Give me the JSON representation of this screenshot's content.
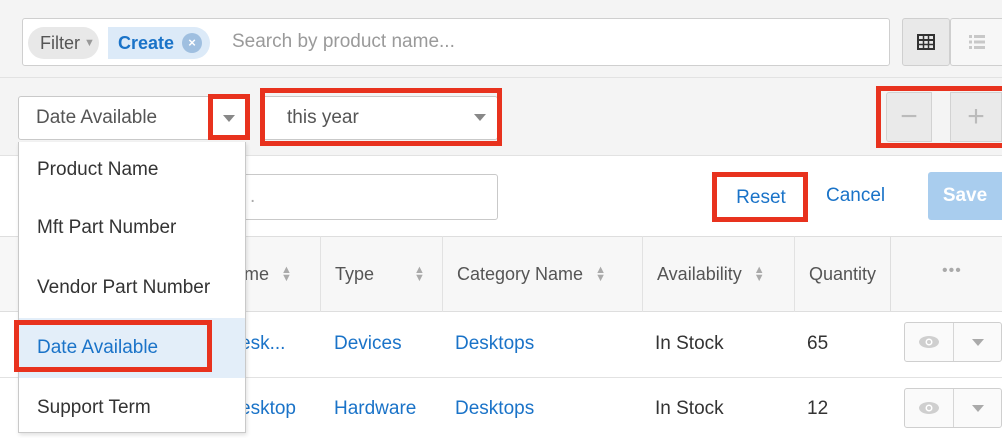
{
  "search": {
    "filter_label": "Filter",
    "create_label": "Create",
    "clear_label": "×",
    "placeholder": "Search by product name..."
  },
  "filter_row": {
    "field_value": "Date Available",
    "operator_value": "this year",
    "minus_label": "−",
    "plus_label": "+"
  },
  "actions": {
    "value_placeholder": ".",
    "reset_label": "Reset",
    "cancel_label": "Cancel",
    "save_label": "Save"
  },
  "field_options": [
    "Product Name",
    "Mft Part Number",
    "Vendor Part Number",
    "Date Available",
    "Support Term"
  ],
  "table": {
    "headers": [
      "me",
      "Type",
      "Category Name",
      "Availability",
      "Quantity"
    ],
    "more_label": "•••",
    "rows": [
      {
        "name": "esk...",
        "type": "Devices",
        "category": "Desktops",
        "availability": "In Stock",
        "quantity": "65"
      },
      {
        "name": "esktop",
        "type": "Hardware",
        "category": "Desktops",
        "availability": "In Stock",
        "quantity": "12"
      }
    ]
  },
  "colors": {
    "link": "#1a73c8",
    "highlight_box": "#e8321e",
    "save_button": "#a9cdee",
    "selected_option_bg": "#e3eef9"
  },
  "icons": [
    "close-icon",
    "table-view-icon",
    "list-view-icon",
    "chevron-down-icon",
    "sort-icon",
    "eye-icon"
  ]
}
